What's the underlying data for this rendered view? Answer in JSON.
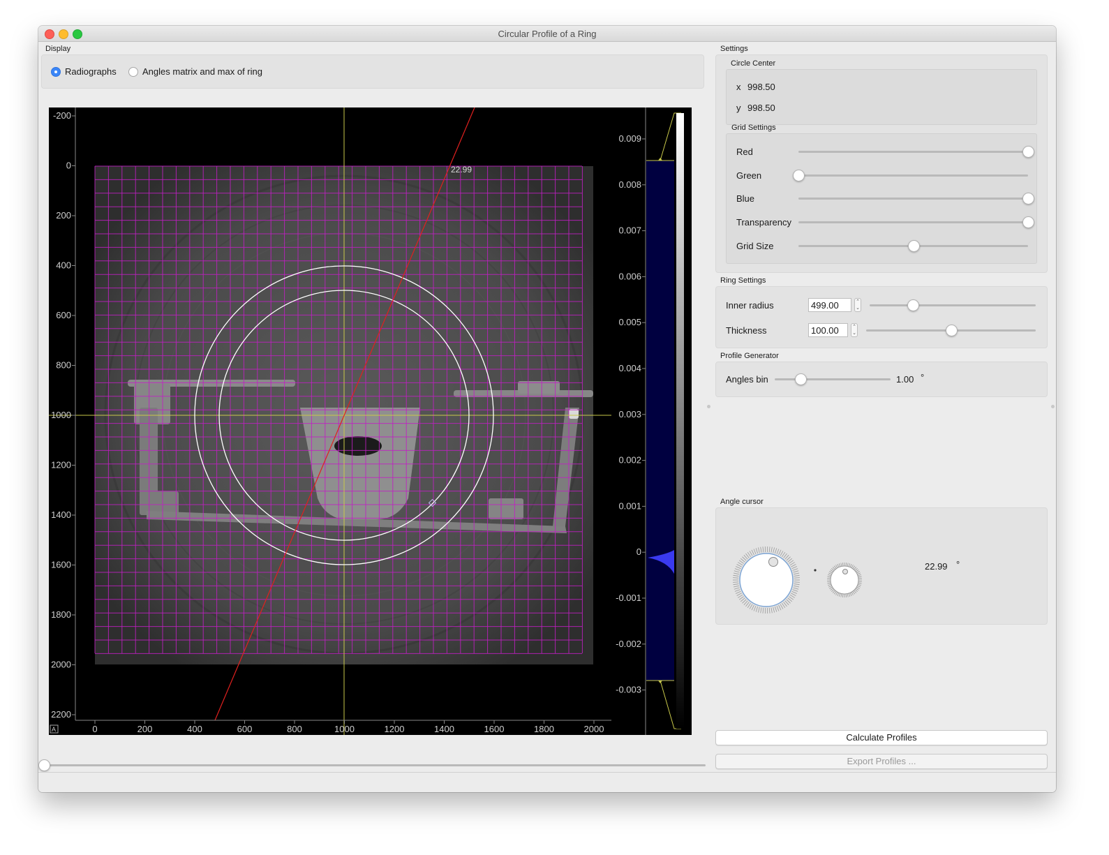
{
  "window": {
    "title": "Circular Profile of a Ring"
  },
  "display": {
    "label": "Display",
    "options": [
      {
        "label": "Radiographs",
        "selected": true
      },
      {
        "label": "Angles matrix and max of ring",
        "selected": false
      }
    ]
  },
  "image_view": {
    "x_ticks": [
      "0",
      "200",
      "400",
      "600",
      "800",
      "1000",
      "1200",
      "1400",
      "1600",
      "1800",
      "2000"
    ],
    "y_ticks": [
      "-200",
      "0",
      "200",
      "400",
      "600",
      "800",
      "1000",
      "1200",
      "1400",
      "1600",
      "1800",
      "2000",
      "2200"
    ],
    "angle_label": "22.99",
    "corner_button": "A",
    "grid_color": "#c21ec4",
    "crosshair_color": "#c9c94a",
    "angle_line_color": "#e0201f",
    "ring_color": "#ffffff"
  },
  "histogram": {
    "ticks": [
      "0.009",
      "0.008",
      "0.007",
      "0.006",
      "0.005",
      "0.004",
      "0.003",
      "0.002",
      "0.001",
      "0",
      "-0.001",
      "-0.002",
      "-0.003"
    ],
    "fill_color": "#000040",
    "peak_color": "#3a3af0"
  },
  "settings": {
    "label": "Settings",
    "circle_center": {
      "label": "Circle Center",
      "x_label": "x",
      "x_value": "998.50",
      "y_label": "y",
      "y_value": "998.50"
    },
    "grid_settings": {
      "label": "Grid Settings",
      "sliders": [
        {
          "label": "Red",
          "value": 1.0
        },
        {
          "label": "Green",
          "value": 0.0
        },
        {
          "label": "Blue",
          "value": 1.0
        },
        {
          "label": "Transparency",
          "value": 1.0
        },
        {
          "label": "Grid Size",
          "value": 0.5
        }
      ]
    }
  },
  "ring_settings": {
    "label": "Ring Settings",
    "inner_radius_label": "Inner radius",
    "inner_radius_value": "499.00",
    "inner_radius_slider": 0.26,
    "thickness_label": "Thickness",
    "thickness_value": "100.00",
    "thickness_slider": 0.5
  },
  "profile_generator": {
    "label": "Profile Generator",
    "angles_bin_label": "Angles bin",
    "angles_bin_value": "1.00",
    "angles_bin_unit": "°",
    "angles_bin_slider": 0.22
  },
  "angle_cursor": {
    "label": "Angle cursor",
    "value": "22.99",
    "unit": "°",
    "separator": "."
  },
  "buttons": {
    "calculate": "Calculate Profiles",
    "export": "Export Profiles ..."
  },
  "bottom_slider": {
    "value": 0.0
  }
}
